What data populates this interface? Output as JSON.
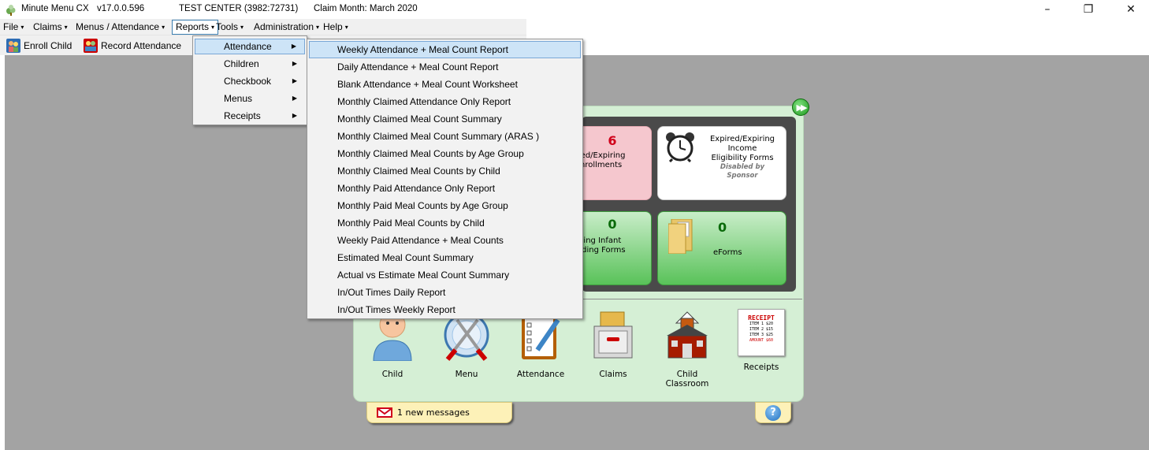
{
  "window": {
    "app_name": "Minute Menu CX",
    "version": "v17.0.0.596",
    "center": "TEST CENTER (3982:72731)",
    "claim_month": "Claim Month: March 2020",
    "controls": {
      "minimize": "–",
      "restore": "❐",
      "close": "✕"
    }
  },
  "menubar": {
    "items": [
      {
        "label": "File",
        "caret": "▾"
      },
      {
        "label": "Claims",
        "caret": "▾"
      },
      {
        "label": "Menus / Attendance",
        "caret": "▾"
      },
      {
        "label": "Reports",
        "caret": "▾"
      },
      {
        "label": "Tools",
        "caret": "▾"
      },
      {
        "label": "Administration",
        "caret": "▾"
      },
      {
        "label": "Help",
        "caret": "▾"
      }
    ]
  },
  "toolbar": {
    "enroll_child": "Enroll Child",
    "record_attendance": "Record Attendance"
  },
  "reports_submenu": {
    "items": [
      {
        "label": "Attendance",
        "arrow": "▶"
      },
      {
        "label": "Children",
        "arrow": "▶"
      },
      {
        "label": "Checkbook",
        "arrow": "▶"
      },
      {
        "label": "Menus",
        "arrow": "▶"
      },
      {
        "label": "Receipts",
        "arrow": "▶"
      }
    ]
  },
  "attendance_reports": {
    "items": [
      "Weekly Attendance + Meal Count Report",
      "Daily Attendance + Meal Count Report",
      "Blank Attendance + Meal Count Worksheet",
      "Monthly Claimed Attendance Only Report",
      "Monthly Claimed Meal Count Summary",
      "Monthly Claimed Meal Count Summary (ARAS )",
      "Monthly Claimed Meal Counts by Age Group",
      "Monthly Claimed Meal Counts by Child",
      "Monthly Paid Attendance Only Report",
      "Monthly Paid Meal Counts by Age Group",
      "Monthly Paid Meal Counts by Child",
      "Weekly Paid Attendance + Meal Counts",
      "Estimated Meal Count Summary",
      "Actual vs Estimate Meal Count Summary",
      "In/Out Times Daily Report",
      "In/Out Times Weekly Report"
    ]
  },
  "dashboard": {
    "expiring_enrollments": {
      "count": "6",
      "label_line1": "ired/Expiring",
      "label_line2": "nrollments"
    },
    "income_eligibility": {
      "line1": "Expired/Expiring",
      "line2": "Income",
      "line3": "Eligibility Forms",
      "sub1": "Disabled by",
      "sub2": "Sponsor"
    },
    "infant_feeding": {
      "count": "0",
      "label_line1": "ssing Infant",
      "label_line2": "eding Forms"
    },
    "eforms": {
      "count": "0",
      "label": "eForms"
    },
    "dock": [
      {
        "label": "Child"
      },
      {
        "label": "Menu"
      },
      {
        "label": "Attendance"
      },
      {
        "label": "Claims"
      },
      {
        "label": "Child Classroom"
      },
      {
        "label": "Receipts"
      }
    ],
    "receipt_art": {
      "title": "RECEIPT",
      "line1": "ITEM 1 $20",
      "line2": "ITEM 2 $15",
      "line3": "ITEM 3 $25",
      "total": "AMOUNT $60"
    },
    "messages": "1 new messages",
    "help": "?"
  },
  "colors": {
    "workspace": "#a3a3a3",
    "panel": "#d5efd5",
    "highlight": "#cde4f7",
    "alert_red": "#d0021b"
  }
}
